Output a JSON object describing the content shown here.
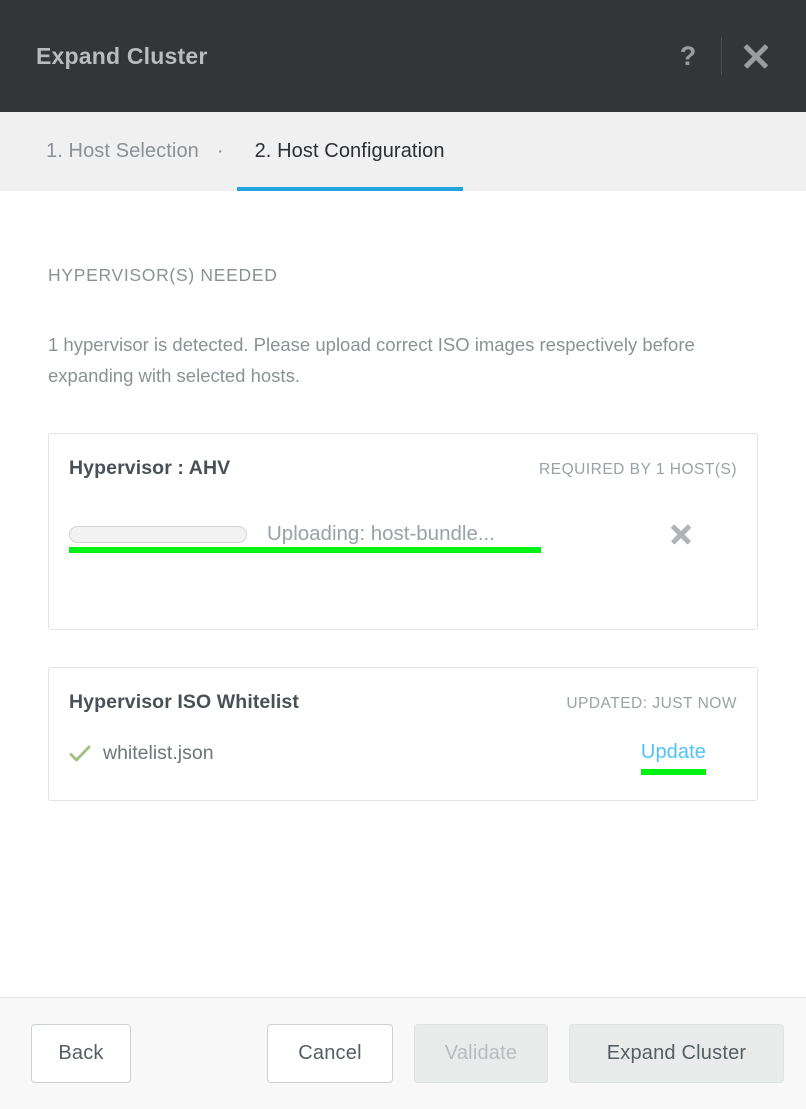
{
  "window": {
    "title": "Expand Cluster",
    "help_icon": "question-mark-icon",
    "close_icon": "close-icon"
  },
  "steps": [
    {
      "label": "1. Host Selection",
      "active": false
    },
    {
      "separator": "·"
    },
    {
      "label": "2. Host Configuration",
      "active": true
    }
  ],
  "step_separator": "·",
  "main": {
    "section_title": "HYPERVISOR(S) NEEDED",
    "section_description": "1 hypervisor is detected. Please upload correct ISO images respectively before expanding with selected hosts.",
    "hypervisor_card": {
      "title": "Hypervisor : AHV",
      "meta": "REQUIRED BY 1 HOST(S)",
      "upload_status": "Uploading: host-bundle...",
      "progress_percent": 0,
      "cancel_icon": "close-icon",
      "highlight_color": "#00f215"
    },
    "whitelist_card": {
      "title": "Hypervisor ISO Whitelist",
      "meta": "UPDATED: JUST NOW",
      "file_name": "whitelist.json",
      "status_icon": "check-icon",
      "status_icon_color": "#a3c184",
      "update_label": "Update",
      "update_link_color": "#4fc3f7",
      "highlight_color": "#00f215"
    }
  },
  "footer": {
    "back_label": "Back",
    "cancel_label": "Cancel",
    "validate_label": "Validate",
    "expand_label": "Expand Cluster"
  },
  "colors": {
    "titlebar_bg": "#333537",
    "active_tab_underline": "#22a5dc",
    "highlight_green": "#00f215",
    "link_blue": "#4fc3f7",
    "check_green": "#a3c184"
  }
}
